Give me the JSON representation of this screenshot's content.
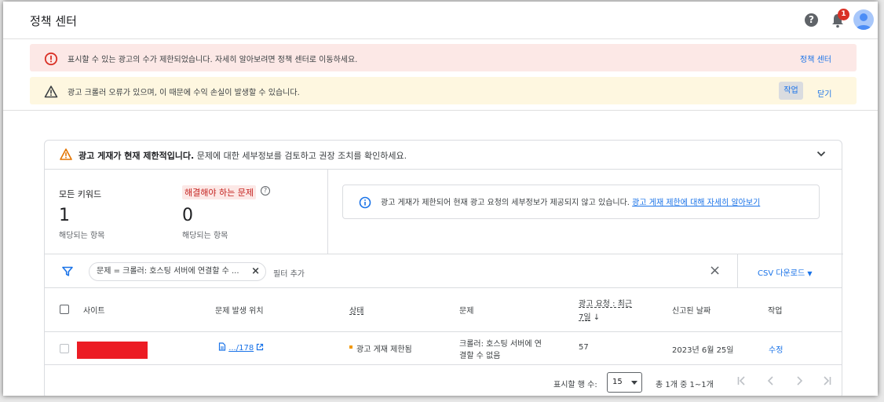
{
  "header": {
    "title": "정책 센터",
    "help_icon": "help-circle-icon",
    "notification_icon": "bell-icon",
    "notification_count": "1",
    "avatar_icon": "user-avatar"
  },
  "banners": {
    "error": {
      "icon": "error-circle-icon",
      "text": "표시할 수 있는 광고의 수가 제한되었습니다. 자세히 알아보려면 정책 센터로 이동하세요.",
      "link_label": "정책 센터"
    },
    "warning": {
      "icon": "warning-triangle-icon",
      "text": "광고 크롤러 오류가 있으며, 이 때문에 수익 손실이 발생할 수 있습니다.",
      "action_label": "작업",
      "dismiss_label": "닫기"
    }
  },
  "card": {
    "header_bold": "광고 게재가 현재 제한적입니다.",
    "header_rest": " 문제에 대한 세부정보를 검토하고 권장 조치를 확인하세요.",
    "stats": {
      "all_keywords_label": "모든 키워드",
      "all_keywords_value": "1",
      "all_keywords_sub": "해당되는 항목",
      "issues_label": "해결해야 하는 문제",
      "issues_value": "0",
      "issues_sub": "해당되는 항목"
    },
    "info": {
      "text": "광고 게재가 제한되어 현재 광고 요청의 세부정보가 제공되지 않고 있습니다. ",
      "link": "광고 게재 제한에 대해 자세히 알아보기"
    },
    "filter": {
      "chip_label": "문제 = 크롤러: 호스팅 서버에 연결할 수 ...",
      "add_filter": "필터 추가",
      "csv_label": "CSV 다운로드"
    },
    "table": {
      "columns": {
        "site": "사이트",
        "location": "문제 발생 위치",
        "status": "상태",
        "issue": "문제",
        "requests_line1": "광고 요청 : 최근",
        "requests_line2": "7일",
        "reported": "신고된 날짜",
        "action": "작업"
      },
      "rows": [
        {
          "site": "",
          "location": ".../178",
          "status": "광고 게재 제한됨",
          "issue_line1": "크롤러: 호스팅 서버에 연",
          "issue_line2": "결할 수 없음",
          "requests": "57",
          "reported": "2023년 6월 25일",
          "action": "수정"
        }
      ]
    },
    "pagination": {
      "rows_label": "표시할 행 수:",
      "rows_value": "15",
      "range": "총 1개 중 1~1개"
    }
  },
  "colors": {
    "accent": "#1a73e8",
    "error": "#d93025",
    "warning": "#f29900",
    "error_bg": "#fce8e6",
    "warning_bg": "#fef7e0"
  }
}
